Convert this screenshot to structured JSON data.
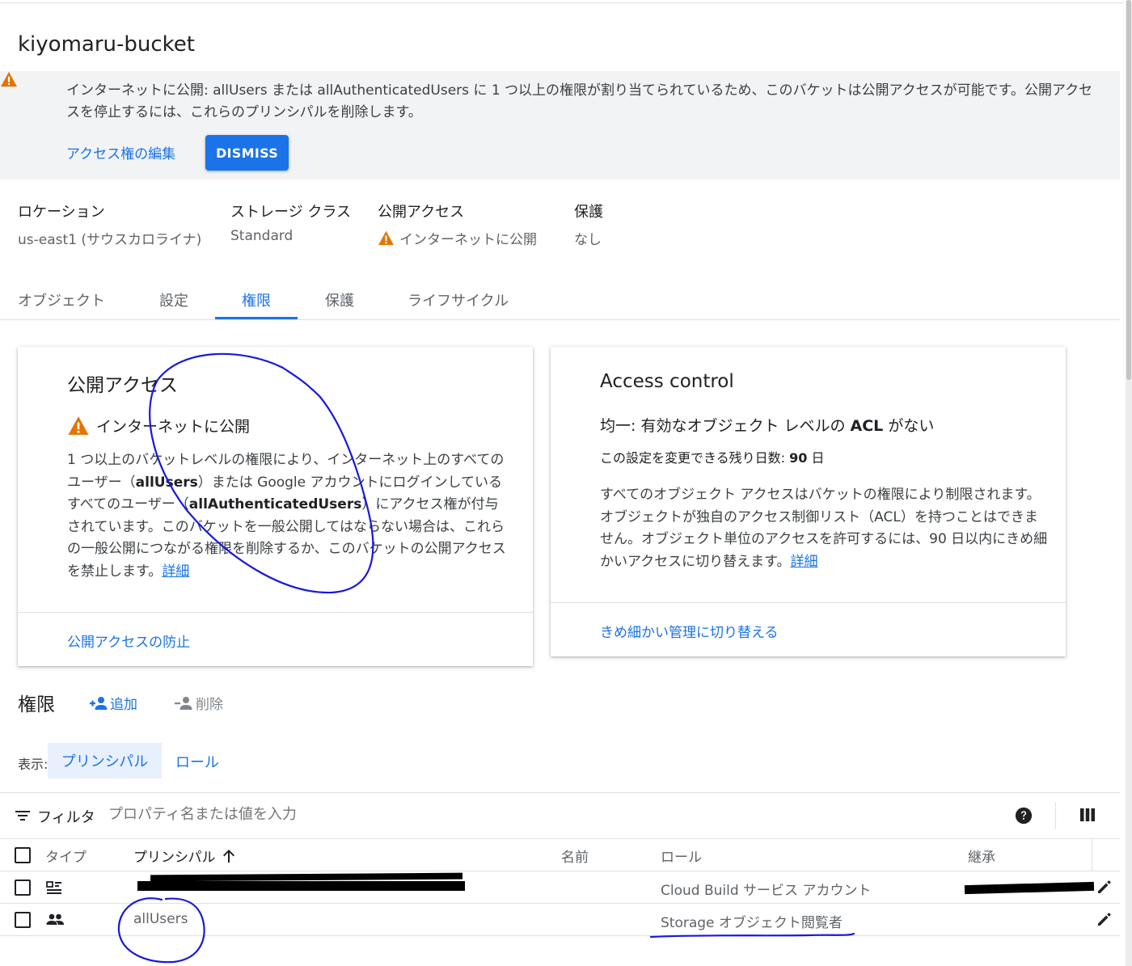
{
  "bucket": {
    "name": "kiyomaru-bucket"
  },
  "banner": {
    "text": "インターネットに公開: allUsers または allAuthenticatedUsers に 1 つ以上の権限が割り当てられているため、このバケットは公開アクセスが可能です。公開アクセスを停止するには、これらのプリンシパルを削除します。",
    "edit_link": "アクセス権の編集",
    "dismiss": "DISMISS"
  },
  "meta": {
    "location_label": "ロケーション",
    "location_value": "us-east1 (サウスカロライナ)",
    "storage_label": "ストレージ クラス",
    "storage_value": "Standard",
    "access_label": "公開アクセス",
    "access_value": "インターネットに公開",
    "protection_label": "保護",
    "protection_value": "なし"
  },
  "tabs": [
    {
      "label": "オブジェクト"
    },
    {
      "label": "設定"
    },
    {
      "label": "権限"
    },
    {
      "label": "保護"
    },
    {
      "label": "ライフサイクル"
    }
  ],
  "public_card": {
    "title": "公開アクセス",
    "status": "インターネットに公開",
    "body_1": "1 つ以上のバケットレベルの権限により、インターネット上のすべてのユーザー（",
    "body_b1": "allUsers",
    "body_2": "）または Google アカウントにログインしているすべてのユーザー（",
    "body_b2": "allAuthenticatedUsers",
    "body_3": "）にアクセス権が付与されています。このバケットを一般公開してはならない場合は、これらの一般公開につながる権限を削除するか、このバケットの公開アクセスを禁止します。",
    "details_link": "詳細",
    "action": "公開アクセスの防止"
  },
  "access_card": {
    "title": "Access control",
    "subtitle_1": "均一: 有効なオブジェクト レベルの ",
    "subtitle_b": "ACL",
    "subtitle_2": " がない",
    "days_1": "この設定を変更できる残り日数: ",
    "days_b": "90",
    "days_2": " 日",
    "body": "すべてのオブジェクト アクセスはバケットの権限により制限されます。オブジェクトが独自のアクセス制御リスト（ACL）を持つことはできません。オブジェクト単位のアクセスを許可するには、90 日以内にきめ細かいアクセスに切り替えます。",
    "details_link": "詳細",
    "action": "きめ細かい管理に切り替える"
  },
  "permissions": {
    "title": "権限",
    "add": "追加",
    "remove": "削除",
    "view_label": "表示:",
    "view_principal": "プリンシパル",
    "view_role": "ロール",
    "filter_label": "フィルタ",
    "filter_placeholder": "プロパティ名または値を入力",
    "columns": {
      "type": "タイプ",
      "principal": "プリンシパル",
      "name": "名前",
      "role": "ロール",
      "inherited": "継承"
    },
    "rows": [
      {
        "type_icon": "service-account-icon",
        "principal": "",
        "name": "",
        "role": "Cloud Build サービス アカウント",
        "inherited": ""
      },
      {
        "type_icon": "group-icon",
        "principal": "allUsers",
        "name": "",
        "role": "Storage オブジェクト閲覧者",
        "inherited": ""
      }
    ]
  },
  "colors": {
    "accent": "#1a73e8",
    "warning": "#e37400",
    "annotation": "#1818e0"
  }
}
